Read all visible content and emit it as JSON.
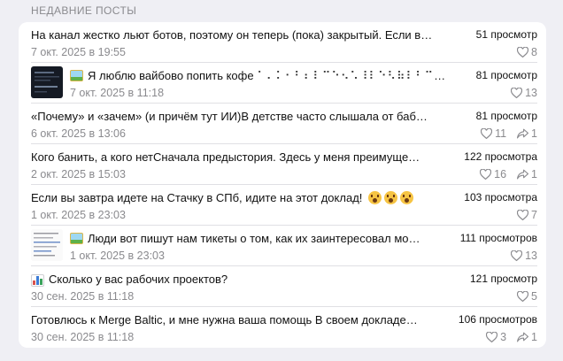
{
  "section_title": "НЕДАВНИЕ ПОСТЫ",
  "colors": {
    "background": "#efeff4",
    "card": "#ffffff",
    "muted": "#8a8a8e",
    "separator": "#e0e0e4"
  },
  "posts": [
    {
      "title": "На канал жестко льют ботов, поэтому он теперь (пока) закрытый. Если в…",
      "date": "7 окт. 2025 в 19:55",
      "views": "51 просмотр",
      "likes": "8",
      "reposts": null,
      "icon": null,
      "thumbnail": false
    },
    {
      "title": "Я люблю вайбово попить кофе",
      "title_suffix": "⠁⠄⠅⠂⠃⠆⠇⠉⠑⠢⠡⠸⠇⠑⠣⠷⠇⠃⠉⠒⠢⠡⠖⠁⠈⠉",
      "date": "7 окт. 2025 в 11:18",
      "views": "81 просмотр",
      "likes": "13",
      "reposts": null,
      "icon": "framed-picture-icon",
      "thumbnail": true
    },
    {
      "title": "«Почему» и «зачем» (и причём тут ИИ)В детстве часто слышала от баб…",
      "date": "6 окт. 2025 в 13:06",
      "views": "81 просмотр",
      "likes": "11",
      "reposts": "1",
      "icon": null,
      "thumbnail": false
    },
    {
      "title": "Кого банить, а кого нетСначала предыстория. Здесь у меня преимуще…",
      "date": "2 окт. 2025 в 15:03",
      "views": "122 просмотра",
      "likes": "16",
      "reposts": "1",
      "icon": null,
      "thumbnail": false
    },
    {
      "title": "Если вы завтра идете на Стачку в СПб, идите на этот доклад!",
      "date": "1 окт. 2025 в 23:03",
      "views": "103 просмотра",
      "likes": "7",
      "reposts": null,
      "icon": null,
      "trailing_emoji": "astonished-face-icon",
      "thumbnail": false
    },
    {
      "title": "Люди вот пишут нам тикеты о том, как их заинтересовал мо…",
      "date": "1 окт. 2025 в 23:03",
      "views": "111 просмотров",
      "likes": "13",
      "reposts": null,
      "icon": "framed-picture-icon",
      "thumbnail": true
    },
    {
      "title": "Сколько у вас рабочих проектов?",
      "date": "30 сен. 2025 в 11:18",
      "views": "121 просмотр",
      "likes": "5",
      "reposts": null,
      "icon": "bar-chart-icon",
      "thumbnail": false
    },
    {
      "title": "Готовлюсь к Merge Baltic, и мне нужна ваша помощь В своем докладе…",
      "date": "30 сен. 2025 в 11:18",
      "views": "106 просмотров",
      "likes": "3",
      "reposts": "1",
      "icon": null,
      "thumbnail": false
    }
  ]
}
